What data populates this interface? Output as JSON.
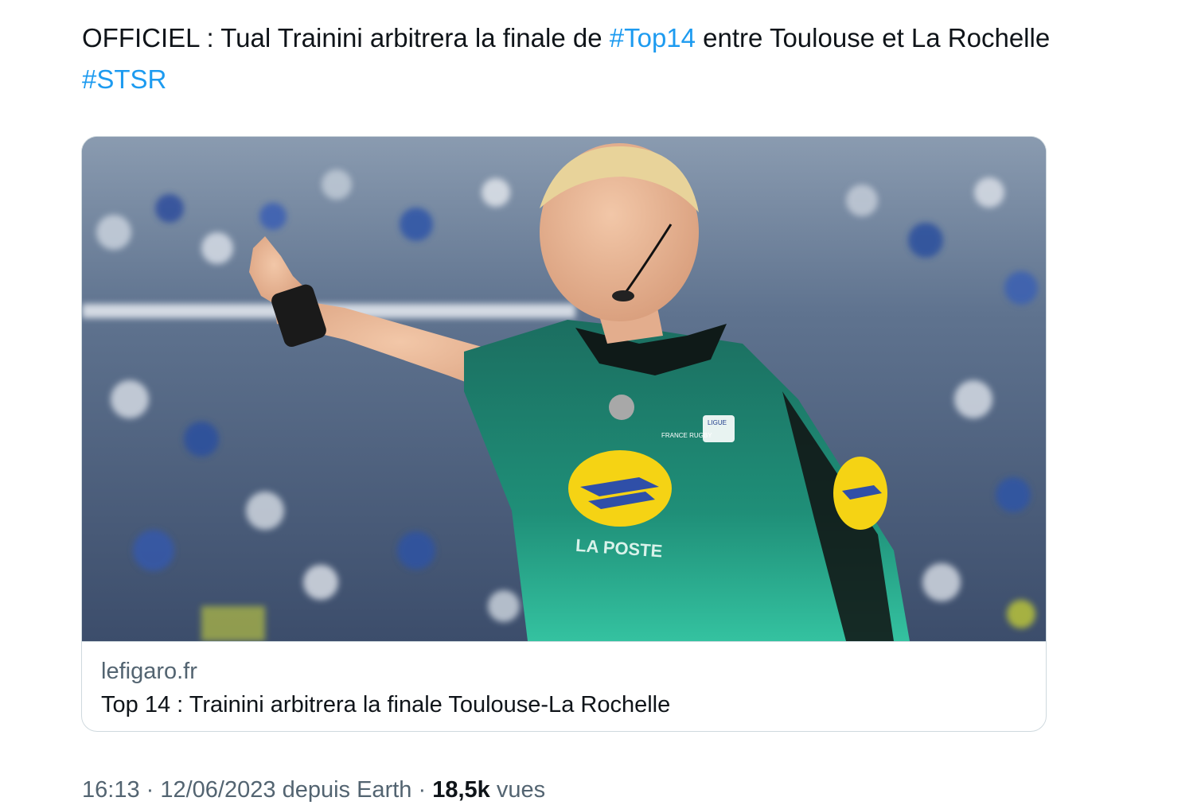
{
  "tweet": {
    "text_part1": "OFFICIEL : Tual Trainini arbitrera la finale de ",
    "hashtag1": "#Top14",
    "text_part2": " entre Toulouse et La Rochelle ",
    "hashtag2": "#STSR"
  },
  "card": {
    "image_alt": "Referee pointing, wearing a green La Poste jersey",
    "jersey_text": "LA POSTE",
    "crest_text": "FRANCE RUGBY",
    "league_badge_text": "LIGUE",
    "domain": "lefigaro.fr",
    "title": "Top 14 : Trainini arbitrera la finale Toulouse-La Rochelle"
  },
  "meta": {
    "time": "16:13",
    "sep1": " · ",
    "date": "12/06/2023",
    "source_prefix": " depuis ",
    "source": "Earth",
    "sep2": " · ",
    "views_count": "18,5k",
    "views_label": " vues"
  },
  "colors": {
    "hashtag": "#1d9bf0",
    "text": "#0f1419",
    "secondary": "#536471",
    "border": "#cfd9de",
    "jersey": "#1f7a6a",
    "logo_yellow": "#f5d314",
    "logo_blue": "#2f4fa8"
  }
}
